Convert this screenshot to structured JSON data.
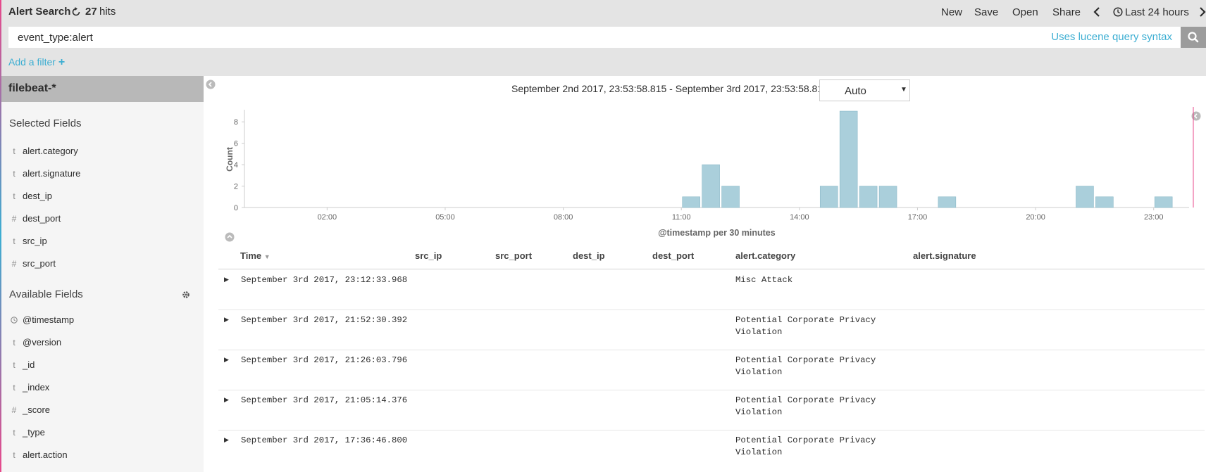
{
  "header": {
    "title": "Alert Search",
    "hits_count": "27",
    "hits_label": "hits",
    "nav": {
      "new": "New",
      "save": "Save",
      "open": "Open",
      "share": "Share",
      "time_picker": "Last 24 hours"
    }
  },
  "query": {
    "value": "event_type:alert",
    "syntax_link": "Uses lucene query syntax"
  },
  "filter": {
    "add_label": "Add a filter",
    "add_icon": "+"
  },
  "sidebar": {
    "index_pattern": "filebeat-*",
    "selected_title": "Selected Fields",
    "selected_fields": [
      {
        "type": "t",
        "name": "alert.category"
      },
      {
        "type": "t",
        "name": "alert.signature"
      },
      {
        "type": "t",
        "name": "dest_ip"
      },
      {
        "type": "#",
        "name": "dest_port"
      },
      {
        "type": "t",
        "name": "src_ip"
      },
      {
        "type": "#",
        "name": "src_port"
      }
    ],
    "available_title": "Available Fields",
    "available_fields": [
      {
        "type": "clock-icon",
        "name": "@timestamp"
      },
      {
        "type": "t",
        "name": "@version"
      },
      {
        "type": "t",
        "name": "_id"
      },
      {
        "type": "t",
        "name": "_index"
      },
      {
        "type": "#",
        "name": "_score"
      },
      {
        "type": "t",
        "name": "_type"
      },
      {
        "type": "t",
        "name": "alert.action"
      }
    ]
  },
  "histogram": {
    "time_range": "September 2nd 2017, 23:53:58.815 - September 3rd 2017, 23:53:58.815 —",
    "interval": "Auto"
  },
  "chart_data": {
    "type": "bar",
    "ylabel": "Count",
    "xlabel": "@timestamp per 30 minutes",
    "ylim": [
      0,
      9
    ],
    "y_ticks": [
      "0",
      "2",
      "4",
      "6",
      "8"
    ],
    "x_ticks": [
      "02:00",
      "05:00",
      "08:00",
      "11:00",
      "14:00",
      "17:00",
      "20:00",
      "23:00"
    ],
    "bar_color": "#aacfdb",
    "bars": [
      {
        "x": "11:00",
        "value": 1
      },
      {
        "x": "11:30",
        "value": 4
      },
      {
        "x": "12:00",
        "value": 2
      },
      {
        "x": "14:30",
        "value": 2
      },
      {
        "x": "15:00",
        "value": 9
      },
      {
        "x": "15:30",
        "value": 2
      },
      {
        "x": "16:00",
        "value": 2
      },
      {
        "x": "17:30",
        "value": 1
      },
      {
        "x": "21:00",
        "value": 2
      },
      {
        "x": "21:30",
        "value": 1
      },
      {
        "x": "23:00",
        "value": 1
      }
    ]
  },
  "table": {
    "columns": [
      "Time",
      "src_ip",
      "src_port",
      "dest_ip",
      "dest_port",
      "alert.category",
      "alert.signature"
    ],
    "rows": [
      {
        "time": "September 3rd 2017, 23:12:33.968",
        "category": "Misc Attack"
      },
      {
        "time": "September 3rd 2017, 21:52:30.392",
        "category": "Potential Corporate Privacy Violation"
      },
      {
        "time": "September 3rd 2017, 21:26:03.796",
        "category": "Potential Corporate Privacy Violation"
      },
      {
        "time": "September 3rd 2017, 21:05:14.376",
        "category": "Potential Corporate Privacy Violation"
      },
      {
        "time": "September 3rd 2017, 17:36:46.800",
        "category": "Potential Corporate Privacy Violation"
      }
    ]
  }
}
